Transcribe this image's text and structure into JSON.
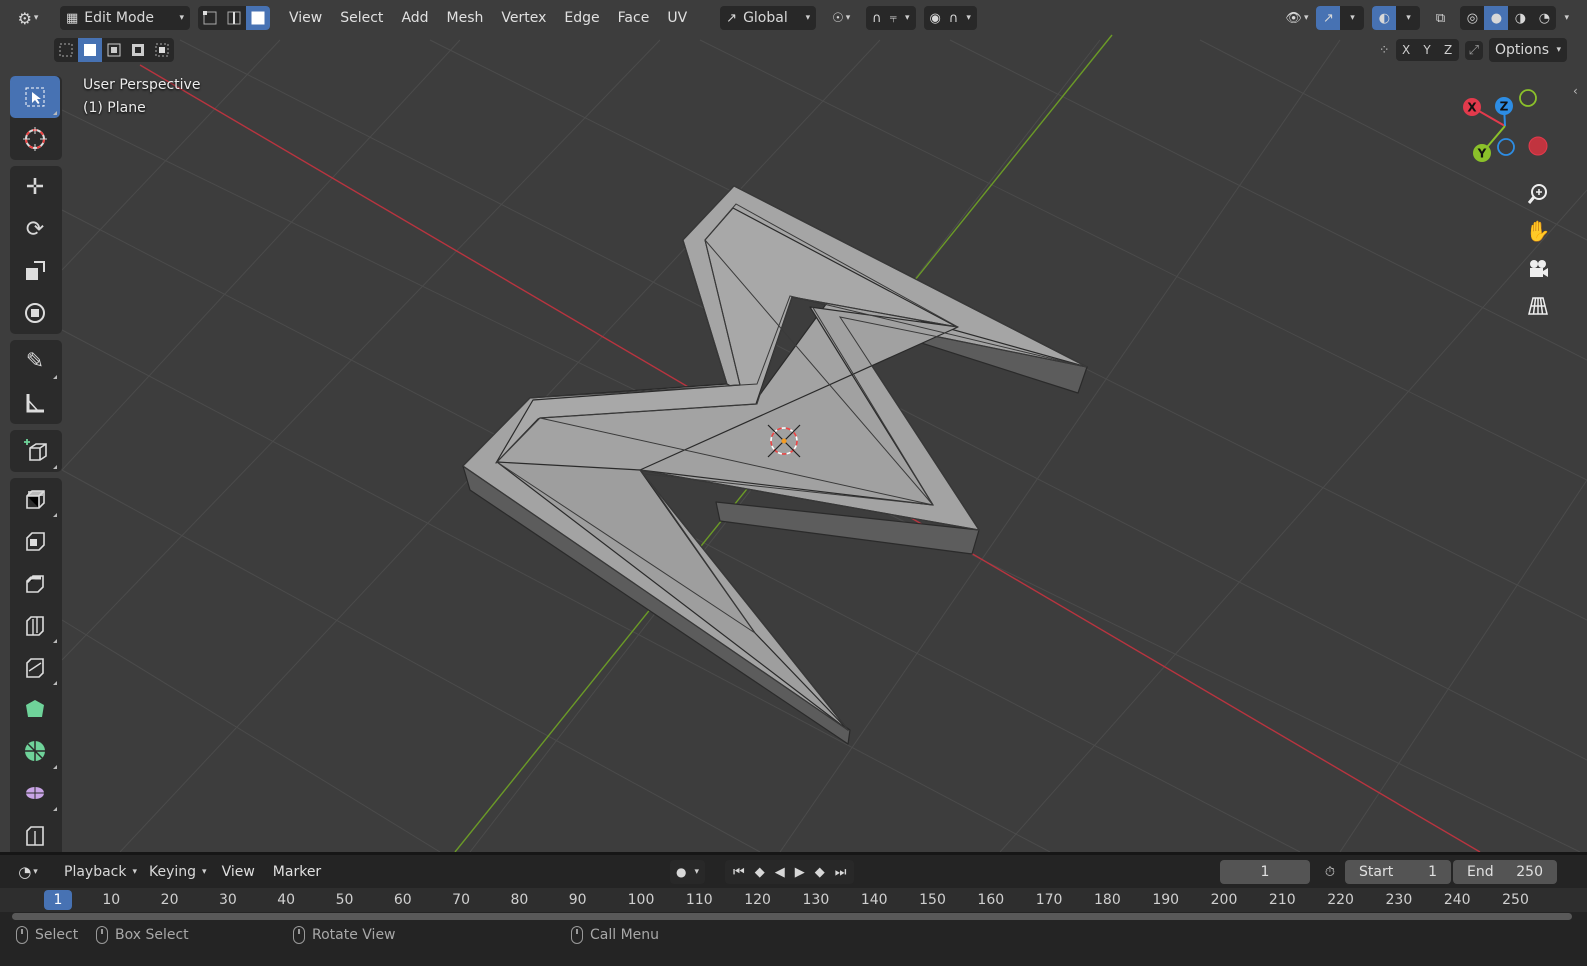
{
  "header": {
    "mode_label": "Edit Mode",
    "menus": [
      "View",
      "Select",
      "Add",
      "Mesh",
      "Vertex",
      "Edge",
      "Face",
      "UV"
    ],
    "transform_orientation": "Global",
    "options_label": "Options",
    "axis_x": "X",
    "axis_y": "Y",
    "axis_z": "Z"
  },
  "viewport": {
    "perspective_label": "User Perspective",
    "object_label": "(1) Plane",
    "gizmo_x": "X",
    "gizmo_y": "Y",
    "gizmo_z": "Z"
  },
  "timeline": {
    "menus": [
      "Playback",
      "Keying",
      "View",
      "Marker"
    ],
    "current_frame": "1",
    "start_label": "Start",
    "start_value": "1",
    "end_label": "End",
    "end_value": "250",
    "ruler_current": "1",
    "ruler_ticks": [
      "10",
      "20",
      "30",
      "40",
      "50",
      "60",
      "70",
      "80",
      "90",
      "100",
      "110",
      "120",
      "130",
      "140",
      "150",
      "160",
      "170",
      "180",
      "190",
      "200",
      "210",
      "220",
      "230",
      "240",
      "250"
    ]
  },
  "status": {
    "select": "Select",
    "box_select": "Box Select",
    "rotate_view": "Rotate View",
    "call_menu": "Call Menu"
  },
  "colors": {
    "accent": "#4772b3",
    "axis_x": "#e33a4c",
    "axis_y": "#8bc12a",
    "axis_z": "#2d8de4"
  }
}
